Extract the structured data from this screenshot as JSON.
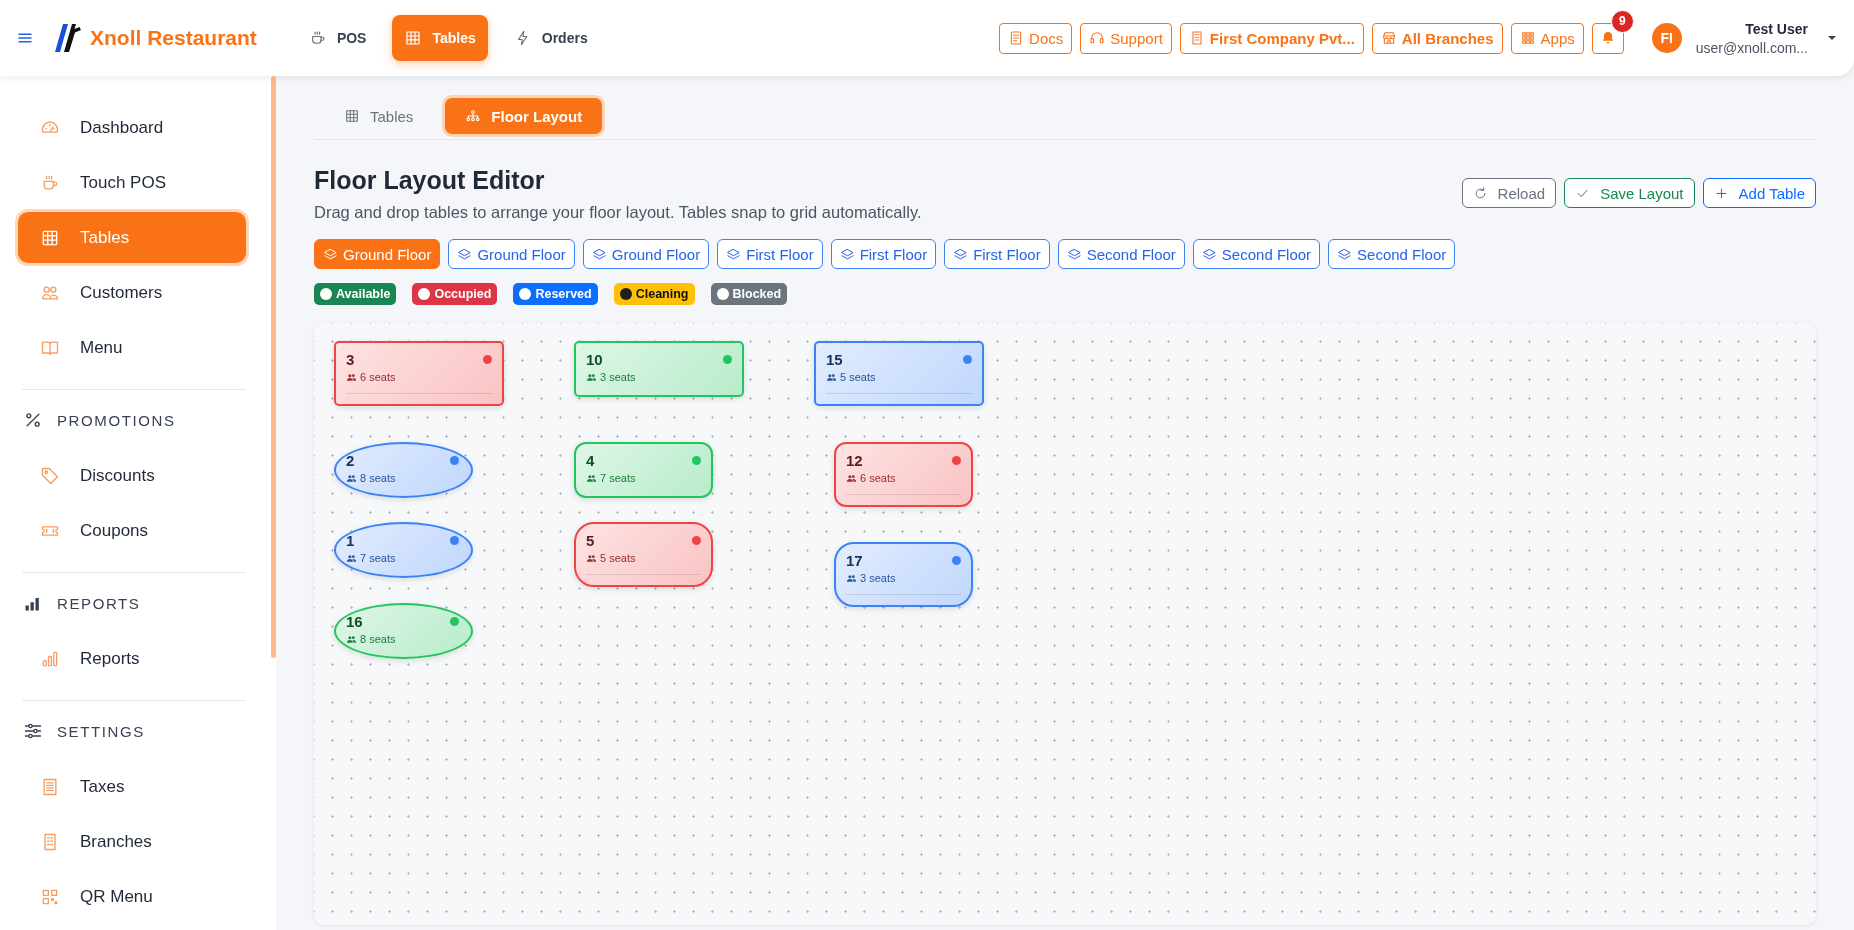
{
  "header": {
    "brand": "Xnoll Restaurant",
    "nav": [
      {
        "label": "POS",
        "selected": false
      },
      {
        "label": "Tables",
        "selected": true
      },
      {
        "label": "Orders",
        "selected": false
      }
    ],
    "tools": [
      {
        "label": "Docs",
        "kind": "link"
      },
      {
        "label": "Support",
        "kind": "link"
      },
      {
        "label": "First Company Pvt...",
        "kind": "selector"
      },
      {
        "label": "All Branches",
        "kind": "selector"
      },
      {
        "label": "Apps",
        "kind": "link"
      }
    ],
    "notifications": {
      "count": "9"
    },
    "user": {
      "initials": "FI",
      "name": "Test User",
      "email": "user@xnoll.com..."
    }
  },
  "sidebar": {
    "sections": [
      {
        "items": [
          {
            "label": "Dashboard",
            "selected": false
          },
          {
            "label": "Touch POS",
            "selected": false
          },
          {
            "label": "Tables",
            "selected": true
          },
          {
            "label": "Customers",
            "selected": false
          },
          {
            "label": "Menu",
            "selected": false
          }
        ]
      },
      {
        "heading": "PROMOTIONS",
        "items": [
          {
            "label": "Discounts",
            "selected": false
          },
          {
            "label": "Coupons",
            "selected": false
          }
        ]
      },
      {
        "heading": "REPORTS",
        "items": [
          {
            "label": "Reports",
            "selected": false
          }
        ]
      },
      {
        "heading": "SETTINGS",
        "items": [
          {
            "label": "Taxes",
            "selected": false
          },
          {
            "label": "Branches",
            "selected": false
          },
          {
            "label": "QR Menu",
            "selected": false
          }
        ]
      }
    ]
  },
  "editor": {
    "tabs": [
      {
        "label": "Tables",
        "selected": false
      },
      {
        "label": "Floor Layout",
        "selected": true
      }
    ],
    "title": "Floor Layout Editor",
    "subtitle": "Drag and drop tables to arrange your floor layout. Tables snap to grid automatically.",
    "actions": [
      {
        "label": "Reload",
        "kind": "neutral"
      },
      {
        "label": "Save Layout",
        "kind": "success"
      },
      {
        "label": "Add Table",
        "kind": "primary"
      }
    ],
    "floors": [
      {
        "label": "Ground Floor",
        "selected": true
      },
      {
        "label": "Ground Floor",
        "selected": false
      },
      {
        "label": "Ground Floor",
        "selected": false
      },
      {
        "label": "First Floor",
        "selected": false
      },
      {
        "label": "First Floor",
        "selected": false
      },
      {
        "label": "First Floor",
        "selected": false
      },
      {
        "label": "Second Floor",
        "selected": false
      },
      {
        "label": "Second Floor",
        "selected": false
      },
      {
        "label": "Second Floor",
        "selected": false
      }
    ],
    "legend": [
      {
        "label": "Available",
        "color": "#198754"
      },
      {
        "label": "Occupied",
        "color": "#dc3545"
      },
      {
        "label": "Reserved",
        "color": "#0d6efd"
      },
      {
        "label": "Cleaning",
        "color": "#ffc107"
      },
      {
        "label": "Blocked",
        "color": "#6c757d"
      }
    ],
    "tables": [
      {
        "number": "3",
        "seats": "6 seats",
        "color": "#ef4444",
        "kind": "rectangle"
      },
      {
        "number": "10",
        "seats": "3 seats",
        "color": "#22c55e",
        "kind": "rectangle"
      },
      {
        "number": "15",
        "seats": "5 seats",
        "color": "#3b82f6",
        "kind": "rectangle"
      },
      {
        "number": "2",
        "seats": "8 seats",
        "color": "#3b82f6",
        "kind": "oval"
      },
      {
        "number": "4",
        "seats": "7 seats",
        "color": "#22c55e",
        "kind": "rounded"
      },
      {
        "number": "12",
        "seats": "6 seats",
        "color": "#ef4444",
        "kind": "rounded"
      },
      {
        "number": "1",
        "seats": "7 seats",
        "color": "#3b82f6",
        "kind": "oval"
      },
      {
        "number": "5",
        "seats": "5 seats",
        "color": "#ef4444",
        "kind": "capsule"
      },
      {
        "number": "17",
        "seats": "3 seats",
        "color": "#3b82f6",
        "kind": "capsule"
      },
      {
        "number": "16",
        "seats": "8 seats",
        "color": "#22c55e",
        "kind": "oval"
      }
    ]
  }
}
